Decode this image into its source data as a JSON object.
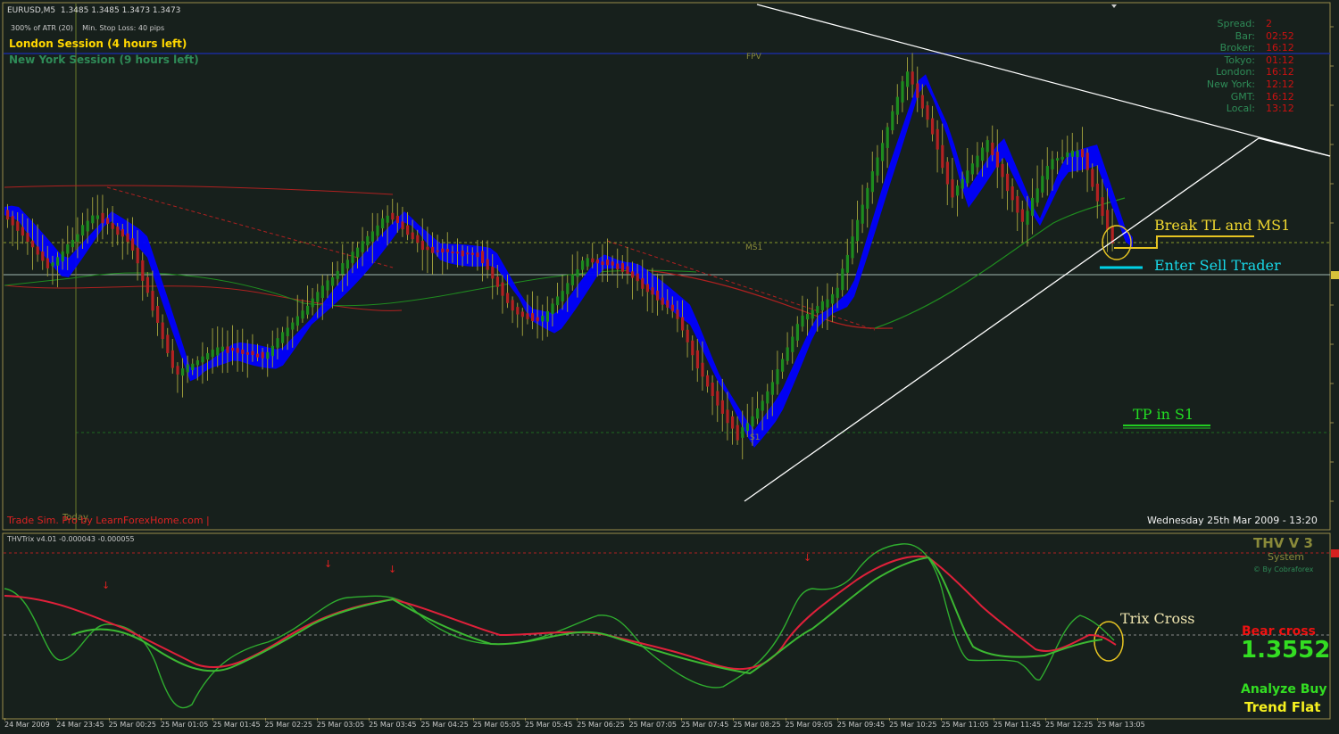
{
  "header": {
    "symbol": "EURUSD,M5",
    "prices": "1.3485 1.3485 1.3473 1.3473",
    "atr": "300% of ATR (20)",
    "stop_loss": "Min. Stop Loss:   40 pips"
  },
  "sessions": {
    "london": "London Session (4 hours left)",
    "newyork": "New York Session (9 hours left)"
  },
  "levels": {
    "fpv": "FPV",
    "ms1": "MS1",
    "s1": "S1",
    "today": "Today"
  },
  "info_panel": [
    {
      "key": "Spread:",
      "value": "2"
    },
    {
      "key": "Bar:",
      "value": "02:52"
    },
    {
      "key": "Broker:",
      "value": "16:12"
    },
    {
      "key": "Tokyo:",
      "value": "01:12"
    },
    {
      "key": "London:",
      "value": "16:12"
    },
    {
      "key": "New York:",
      "value": "12:12"
    },
    {
      "key": "GMT:",
      "value": "16:12"
    },
    {
      "key": "Local:",
      "value": "13:12"
    }
  ],
  "annotations": {
    "break": "Break TL and MS1",
    "enter": "Enter Sell Trader",
    "tp": "TP in S1",
    "trix": "Trix Cross"
  },
  "footer_left": "Trade Sim. Pro by LearnForexHome.com |",
  "footer_date": "Wednesday 25th Mar 2009 - 13:20",
  "indicator": {
    "title": "THVTrix v4.01 -0.000043 -0.000055",
    "brand": "THV V 3",
    "system": "System",
    "by": "© By Cobraforex",
    "bear": "Bear cross",
    "price": "1.3552",
    "analyze": "Analyze Buy",
    "trend": "Trend Flat"
  },
  "time_axis": [
    "24 Mar 2009",
    "24 Mar 23:45",
    "25 Mar 00:25",
    "25 Mar 01:05",
    "25 Mar 01:45",
    "25 Mar 02:25",
    "25 Mar 03:05",
    "25 Mar 03:45",
    "25 Mar 04:25",
    "25 Mar 05:05",
    "25 Mar 05:45",
    "25 Mar 06:25",
    "25 Mar 07:05",
    "25 Mar 07:45",
    "25 Mar 08:25",
    "25 Mar 09:05",
    "25 Mar 09:45",
    "25 Mar 10:25",
    "25 Mar 11:05",
    "25 Mar 11:45",
    "25 Mar 12:25",
    "25 Mar 13:05"
  ],
  "colors": {
    "background": "#17201c",
    "bull": "#1e8c1e",
    "bear": "#b22222",
    "cloud": "#0000ff",
    "trix_red": "#e0203a",
    "trix_green": "#3cb832",
    "trendline": "#ffffff"
  }
}
